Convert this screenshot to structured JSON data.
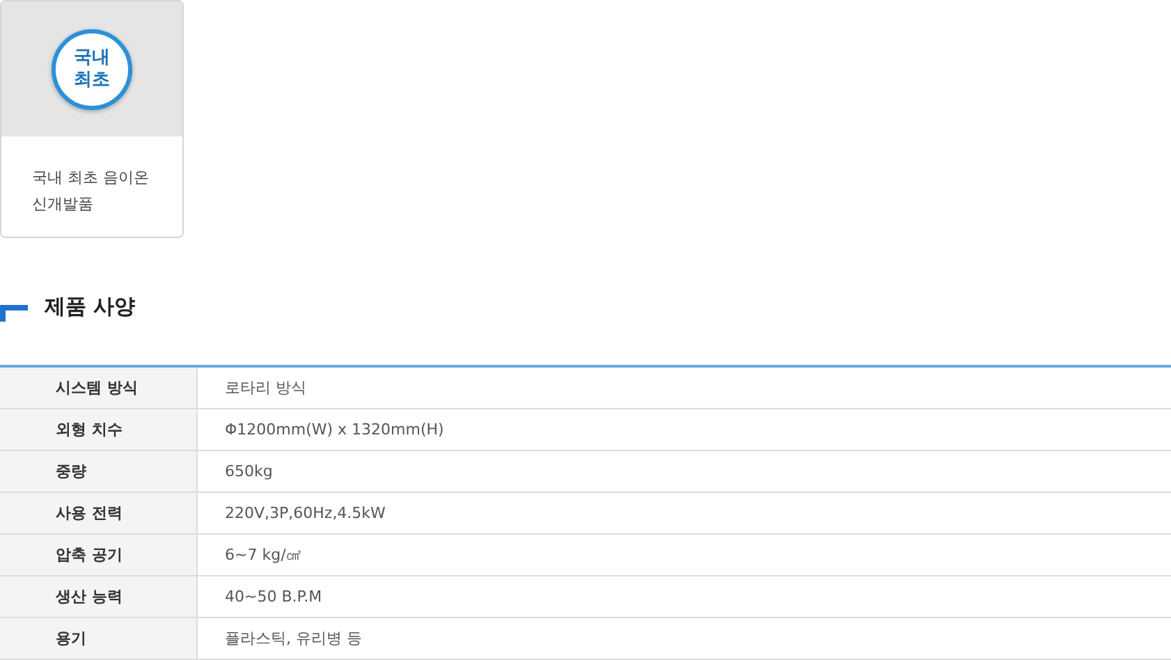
{
  "feature_card": {
    "badge": [
      "국내",
      "최초"
    ],
    "caption": [
      "국내 최초 음이온",
      "신개발품"
    ]
  },
  "section": {
    "title": "제품 사양"
  },
  "specs": [
    {
      "label": "시스템 방식",
      "value": "로타리 방식"
    },
    {
      "label": "외형 치수",
      "value": "Φ1200mm(W) x 1320mm(H)"
    },
    {
      "label": "중량",
      "value": "650kg"
    },
    {
      "label": "사용 전력",
      "value": "220V,3P,60Hz,4.5kW"
    },
    {
      "label": "압축 공기",
      "value": "6~7 kg/㎠"
    },
    {
      "label": "생산 능력",
      "value": "40~50 B.P.M"
    },
    {
      "label": "용기",
      "value": "플라스틱, 유리병 등"
    }
  ]
}
